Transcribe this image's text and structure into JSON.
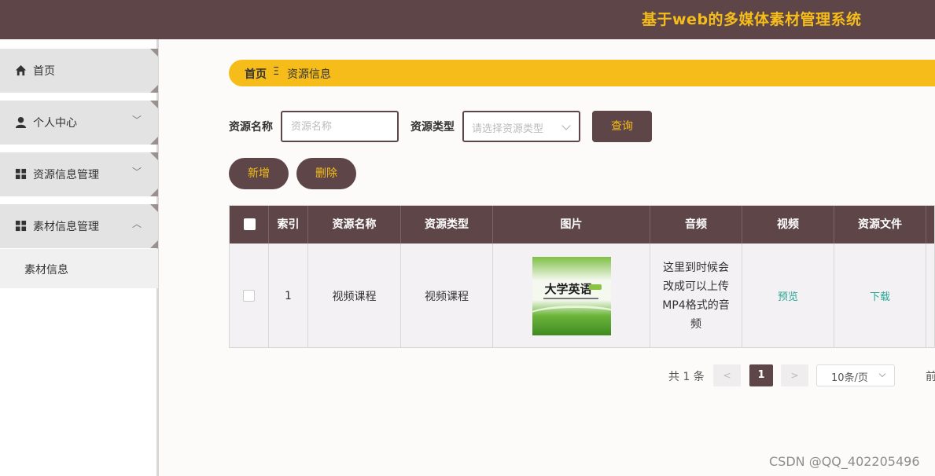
{
  "header": {
    "title": "基于web的多媒体素材管理系统"
  },
  "sidebar": {
    "items": [
      {
        "label": "首页",
        "icon": "home-icon"
      },
      {
        "label": "个人中心",
        "icon": "user-icon",
        "arrow": "﹀"
      },
      {
        "label": "资源信息管理",
        "icon": "grid-icon",
        "arrow": "﹀"
      },
      {
        "label": "素材信息管理",
        "icon": "grid-icon",
        "arrow": "︿"
      }
    ],
    "submenu": {
      "label": "素材信息"
    }
  },
  "breadcrumb": {
    "home": "首页",
    "separator": "Ξ",
    "current": "资源信息"
  },
  "search": {
    "name_label": "资源名称",
    "name_placeholder": "资源名称",
    "type_label": "资源类型",
    "type_placeholder": "请选择资源类型",
    "query_button": "查询"
  },
  "actions": {
    "add": "新增",
    "delete": "删除"
  },
  "table": {
    "headers": [
      "索引",
      "资源名称",
      "资源类型",
      "图片",
      "音频",
      "视频",
      "资源文件"
    ],
    "rows": [
      {
        "index": "1",
        "name": "视频课程",
        "type": "视频课程",
        "image_title": "大学英语",
        "audio": "这里到时候会改成可以上传MP4格式的音频",
        "video": "预览",
        "file": "下载"
      }
    ]
  },
  "pagination": {
    "total": "共 1 条",
    "prev": "<",
    "current": "1",
    "next": ">",
    "page_size": "10条/页",
    "goto": "前"
  },
  "watermark": "CSDN @QQ_402205496",
  "colors": {
    "primary": "#5d4548",
    "accent": "#f6bd1a",
    "link": "#2aa795"
  }
}
